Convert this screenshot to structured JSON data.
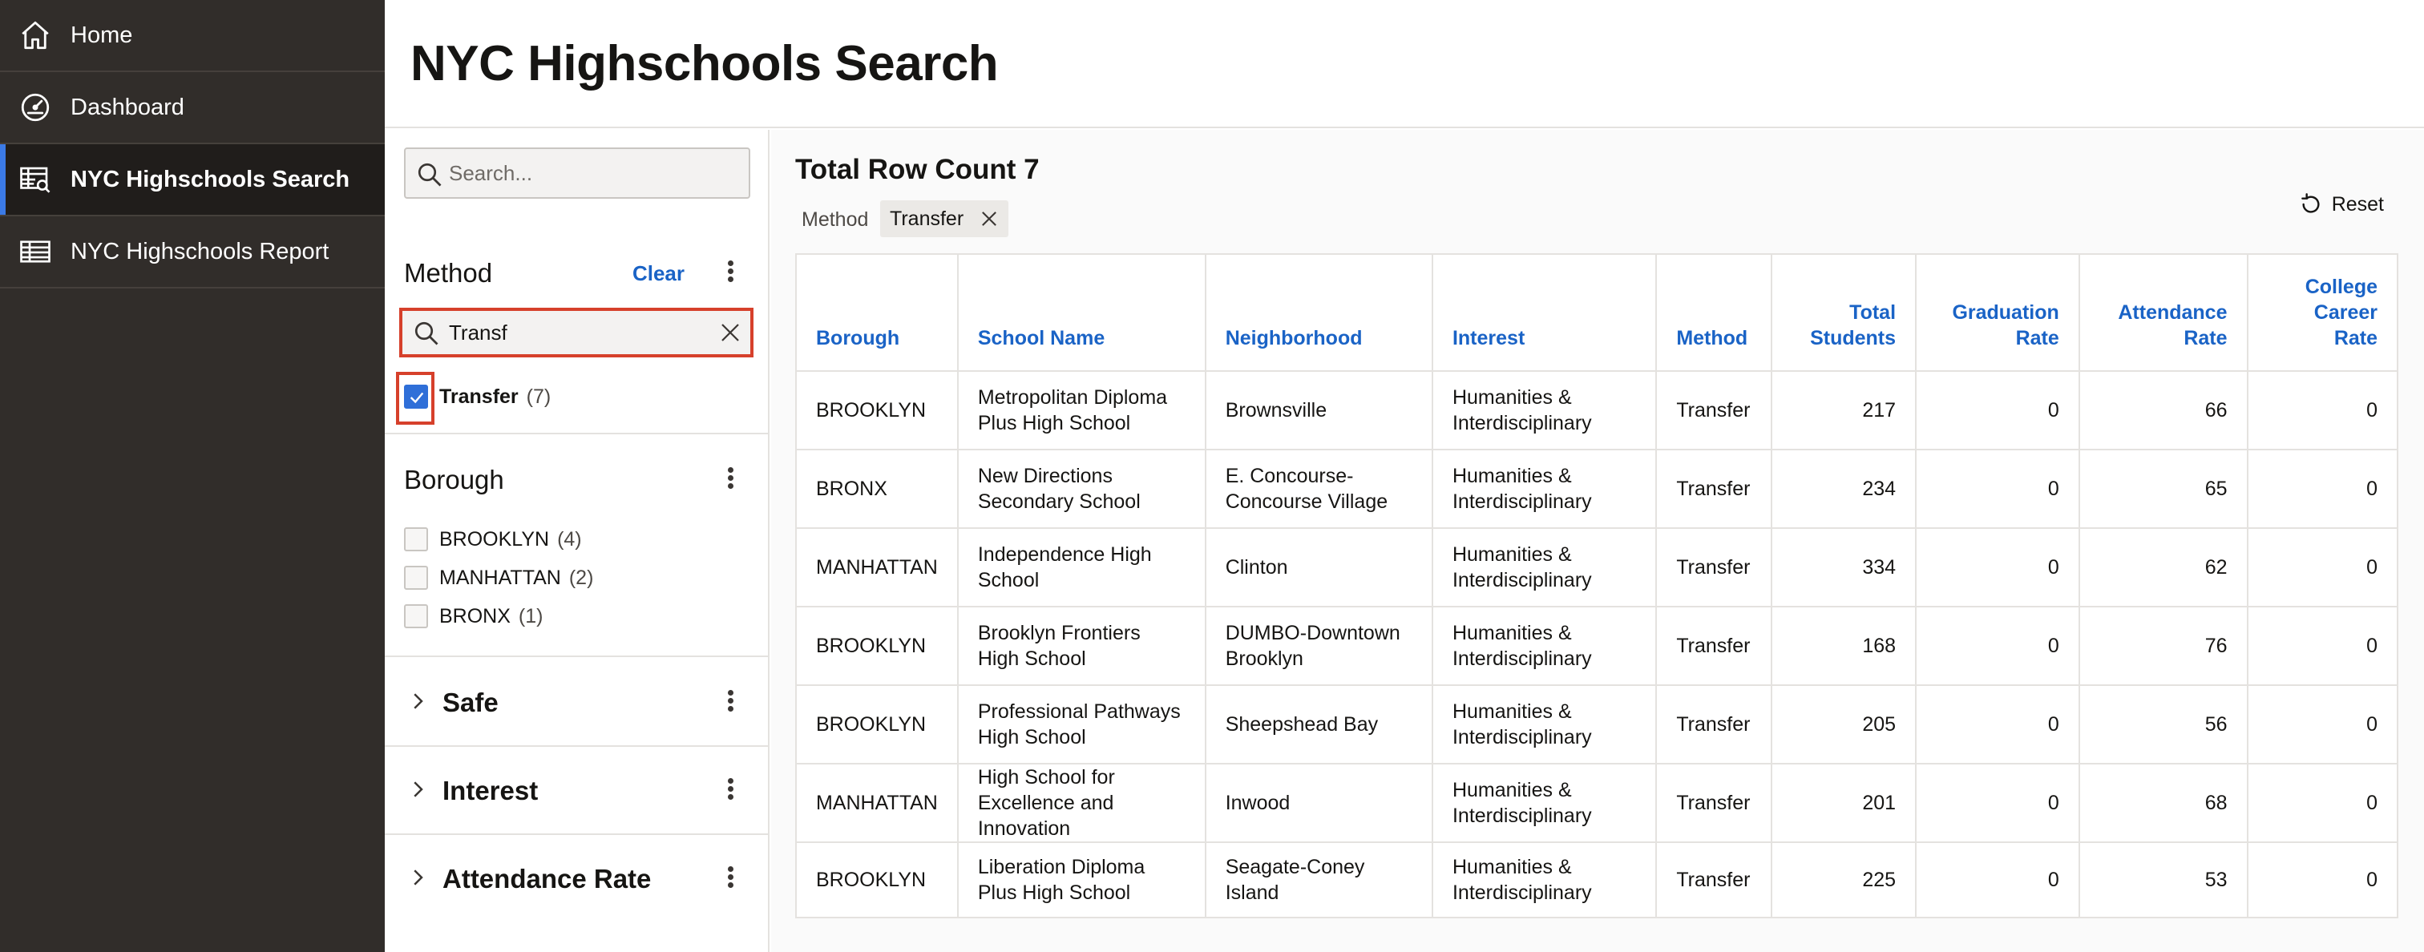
{
  "nav": {
    "items": [
      {
        "label": "Home",
        "icon": "home-icon"
      },
      {
        "label": "Dashboard",
        "icon": "dashboard-gauge-icon"
      },
      {
        "label": "NYC Highschools Search",
        "icon": "table-search-icon",
        "active": true
      },
      {
        "label": "NYC Highschools Report",
        "icon": "table-icon"
      }
    ]
  },
  "header": {
    "title": "NYC Highschools Search"
  },
  "facets": {
    "search_placeholder": "Search...",
    "method": {
      "title": "Method",
      "clear_label": "Clear",
      "filter_value": "Transf",
      "options": [
        {
          "label": "Transfer",
          "count": "(7)",
          "checked": true
        }
      ]
    },
    "borough": {
      "title": "Borough",
      "options": [
        {
          "label": "BROOKLYN",
          "count": "(4)"
        },
        {
          "label": "MANHATTAN",
          "count": "(2)"
        },
        {
          "label": "BRONX",
          "count": "(1)"
        }
      ]
    },
    "collapsed": [
      {
        "title": "Safe"
      },
      {
        "title": "Interest"
      },
      {
        "title": "Attendance Rate"
      }
    ]
  },
  "results": {
    "row_count_label": "Total Row Count 7",
    "active_filter": {
      "facet": "Method",
      "value": "Transfer"
    },
    "reset_label": "Reset",
    "columns": [
      {
        "label": "Borough"
      },
      {
        "label": "School Name"
      },
      {
        "label": "Neighborhood"
      },
      {
        "label": "Interest"
      },
      {
        "label": "Method"
      },
      {
        "label": "Total Students",
        "line1": "Total",
        "line2": "Students"
      },
      {
        "label": "Graduation Rate",
        "line1": "Graduation",
        "line2": "Rate"
      },
      {
        "label": "Attendance Rate",
        "line1": "Attendance",
        "line2": "Rate"
      },
      {
        "label": "College Career Rate",
        "line1": "College",
        "line2": "Career",
        "line3": "Rate"
      }
    ],
    "rows": [
      {
        "borough": "BROOKLYN",
        "school_l1": "Metropolitan Diploma",
        "school_l2": "Plus High School",
        "school_l3": "",
        "neighborhood_l1": "Brownsville",
        "neighborhood_l2": "",
        "interest_l1": "Humanities &",
        "interest_l2": "Interdisciplinary",
        "method": "Transfer",
        "total_students": "217",
        "graduation_rate": "0",
        "attendance_rate": "66",
        "college_career_rate": "0"
      },
      {
        "borough": "BRONX",
        "school_l1": "New Directions",
        "school_l2": "Secondary School",
        "school_l3": "",
        "neighborhood_l1": "E. Concourse-",
        "neighborhood_l2": "Concourse Village",
        "interest_l1": "Humanities &",
        "interest_l2": "Interdisciplinary",
        "method": "Transfer",
        "total_students": "234",
        "graduation_rate": "0",
        "attendance_rate": "65",
        "college_career_rate": "0"
      },
      {
        "borough": "MANHATTAN",
        "school_l1": "Independence High",
        "school_l2": "School",
        "school_l3": "",
        "neighborhood_l1": "Clinton",
        "neighborhood_l2": "",
        "interest_l1": "Humanities &",
        "interest_l2": "Interdisciplinary",
        "method": "Transfer",
        "total_students": "334",
        "graduation_rate": "0",
        "attendance_rate": "62",
        "college_career_rate": "0"
      },
      {
        "borough": "BROOKLYN",
        "school_l1": "Brooklyn Frontiers",
        "school_l2": "High School",
        "school_l3": "",
        "neighborhood_l1": "DUMBO-Downtown",
        "neighborhood_l2": "Brooklyn",
        "interest_l1": "Humanities &",
        "interest_l2": "Interdisciplinary",
        "method": "Transfer",
        "total_students": "168",
        "graduation_rate": "0",
        "attendance_rate": "76",
        "college_career_rate": "0"
      },
      {
        "borough": "BROOKLYN",
        "school_l1": "Professional Pathways",
        "school_l2": "High School",
        "school_l3": "",
        "neighborhood_l1": "Sheepshead Bay",
        "neighborhood_l2": "",
        "interest_l1": "Humanities &",
        "interest_l2": "Interdisciplinary",
        "method": "Transfer",
        "total_students": "205",
        "graduation_rate": "0",
        "attendance_rate": "56",
        "college_career_rate": "0"
      },
      {
        "borough": "MANHATTAN",
        "school_l1": "High School for",
        "school_l2": "Excellence and",
        "school_l3": "Innovation",
        "neighborhood_l1": "Inwood",
        "neighborhood_l2": "",
        "interest_l1": "Humanities &",
        "interest_l2": "Interdisciplinary",
        "method": "Transfer",
        "total_students": "201",
        "graduation_rate": "0",
        "attendance_rate": "68",
        "college_career_rate": "0"
      },
      {
        "borough": "BROOKLYN",
        "school_l1": "Liberation Diploma",
        "school_l2": "Plus High School",
        "school_l3": "",
        "neighborhood_l1": "Seagate-Coney",
        "neighborhood_l2": "Island",
        "interest_l1": "Humanities &",
        "interest_l2": "Interdisciplinary",
        "method": "Transfer",
        "total_students": "225",
        "graduation_rate": "0",
        "attendance_rate": "53",
        "college_career_rate": "0"
      }
    ]
  },
  "colors": {
    "nav_bg": "#312d2a",
    "nav_active_bg": "#201d1b",
    "accent_blue": "#1a63c6",
    "checkbox_blue": "#2f6fd8",
    "highlight_red": "#d6402b"
  }
}
